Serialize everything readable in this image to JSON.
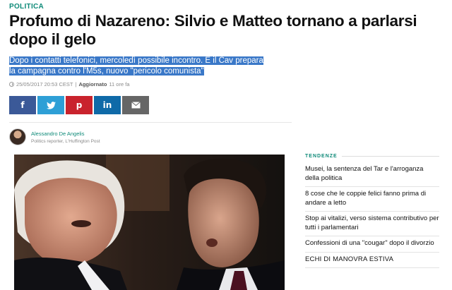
{
  "article": {
    "section": "POLITICA",
    "headline": "Profumo di Nazareno: Silvio e Matteo tornano a parlarsi dopo il gelo",
    "subtitle": "Dopo i contatti telefonici, mercoledì possibile incontro. E il Cav prepara la campagna contro l'M5s, nuovo \"pericolo comunista\"",
    "date": "25/05/2017 20:53 CEST",
    "separator": "|",
    "updated_label": "Aggiornato",
    "updated_ago": "11 ore fa"
  },
  "share": {
    "buttons": [
      {
        "name": "facebook",
        "glyph": "f",
        "icon": "facebook-icon",
        "color": "#3b5998"
      },
      {
        "name": "twitter",
        "glyph": "🐦",
        "icon": "twitter-icon",
        "color": "#2e9fd6"
      },
      {
        "name": "pinterest",
        "glyph": "p",
        "icon": "pinterest-icon",
        "color": "#c9232d"
      },
      {
        "name": "linkedin",
        "glyph": "in",
        "icon": "linkedin-icon",
        "color": "#0f6aa8"
      },
      {
        "name": "email",
        "glyph": "✉",
        "icon": "envelope-icon",
        "color": "#666666"
      }
    ]
  },
  "author": {
    "name": "Alessandro De Angelis",
    "role": "Politics reporter, L'Huffington Post"
  },
  "sidebar": {
    "title": "TENDENZE",
    "items": [
      "Musei, la sentenza del Tar e l'arroganza della politica",
      "8 cose che le coppie felici fanno prima di andare a letto",
      "Stop ai vitalizi, verso sistema contributivo per tutti i parlamentari",
      "Confessioni di una \"cougar\" dopo il divorzio",
      "ECHI DI MANOVRA ESTIVA"
    ]
  },
  "colors": {
    "accent": "#0e8a78",
    "subtitle_highlight": "#3a78c8"
  }
}
